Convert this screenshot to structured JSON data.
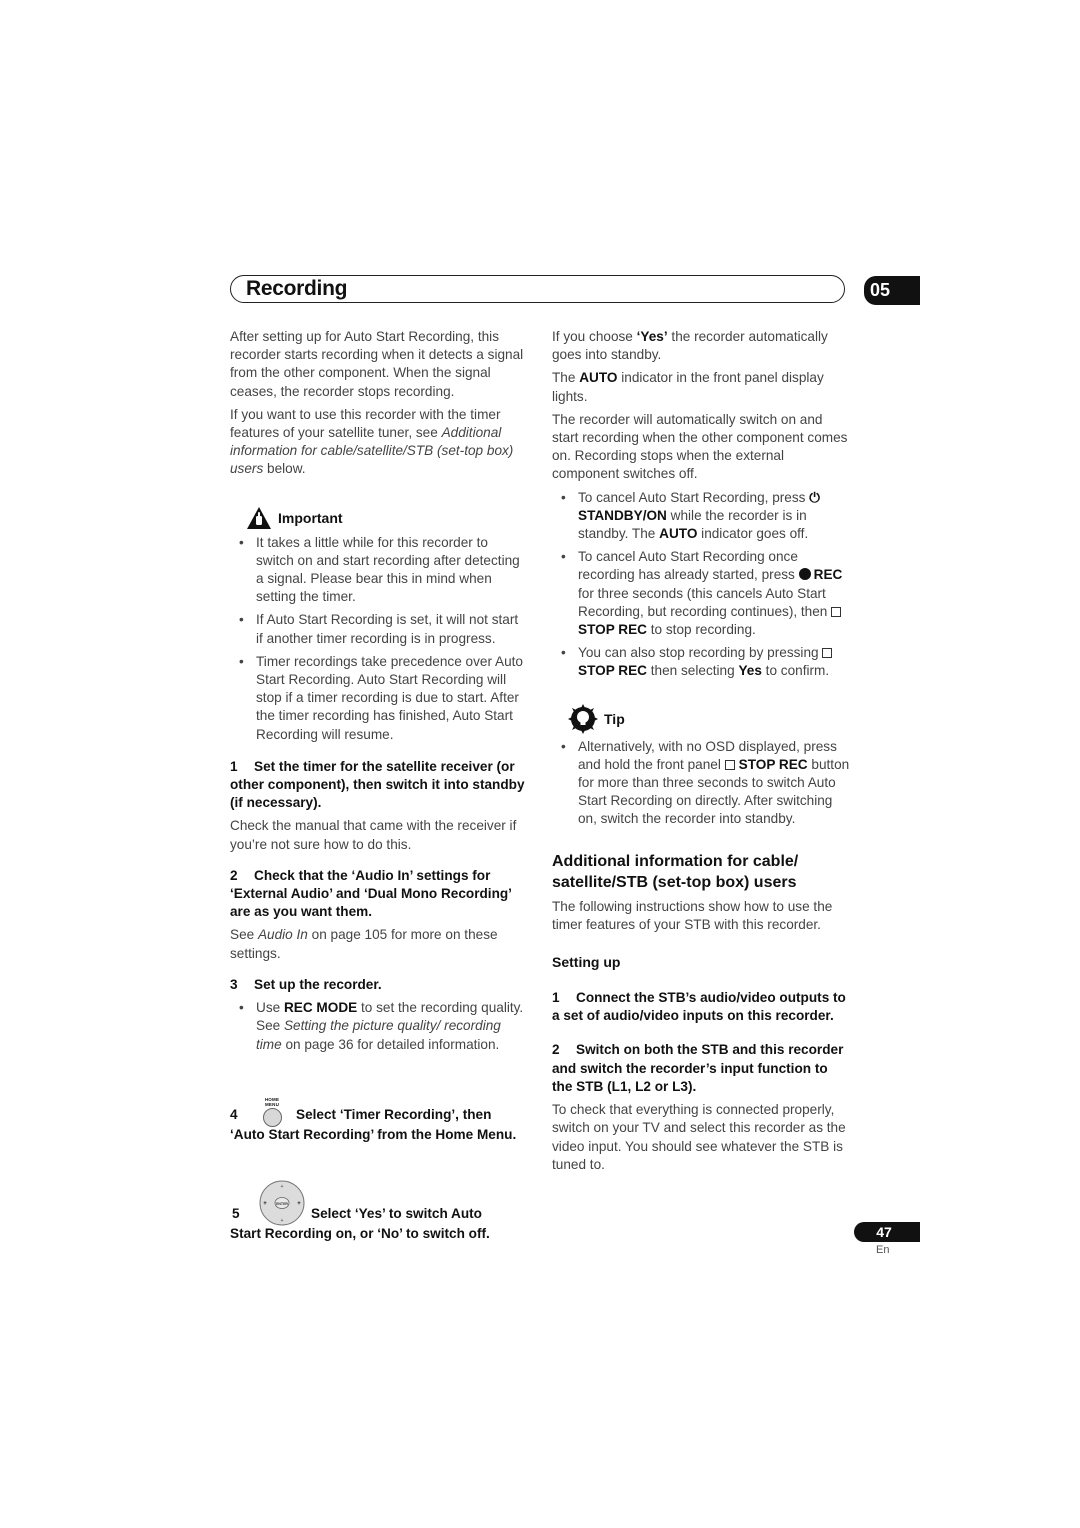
{
  "header": {
    "title": "Recording",
    "chapter": "05"
  },
  "left": {
    "intro1": "After setting up for Auto Start Recording, this recorder starts recording when it detects a signal from the other component. When the signal ceases, the recorder stops recording.",
    "intro2_a": "If you want to use this recorder with the timer features of your satellite tuner, see ",
    "intro2_link": "Additional information for cable/satellite/STB (set-top box) users",
    "intro2_b": " below.",
    "important": {
      "icon": "warning-hand-icon",
      "label": "Important",
      "bullets": [
        "It takes a little while for this recorder to switch on and start recording after detecting a signal. Please bear this in mind when setting the timer.",
        "If Auto Start Recording is set, it will not start if another timer recording is in progress.",
        "Timer recordings take precedence over Auto Start Recording. Auto Start Recording will stop if a timer recording is due to start. After the timer recording has finished, Auto Start Recording will resume."
      ]
    },
    "step1": {
      "num": "1",
      "title": "Set the timer for the satellite receiver (or other component), then switch it into standby (if necessary).",
      "body": "Check the manual that came with the receiver if you’re not sure how to do this."
    },
    "step2": {
      "num": "2",
      "title": "Check that the ‘Audio In’ settings for ‘External Audio’ and ‘Dual Mono Recording’ are as you want them.",
      "body_a": "See ",
      "body_link": "Audio In",
      "body_b": " on page 105 for more on these settings."
    },
    "step3": {
      "num": "3",
      "title": "Set up the recorder.",
      "bullet_a": "Use ",
      "bullet_bold": "REC MODE",
      "bullet_b": " to set the recording quality. See ",
      "bullet_link": "Setting the picture quality/ recording time",
      "bullet_c": " on page 36 for detailed information."
    },
    "step4": {
      "num": "4",
      "icon": "home-menu-button-icon",
      "icon_label": "HOME MENU",
      "title": "Select ‘Timer Recording’, then ‘Auto Start Recording’ from the Home Menu."
    },
    "step5": {
      "num": "5",
      "icon": "enter-dpad-icon",
      "icon_label": "ENTER",
      "title_a": "Select ‘Yes’ to switch Auto",
      "title_b": "Start Recording on, or ‘No’ to switch off."
    }
  },
  "right": {
    "p1_a": "If you choose ",
    "p1_bold": "‘Yes’",
    "p1_b": " the recorder automatically goes into standby.",
    "p2_a": "The ",
    "p2_bold": "AUTO",
    "p2_b": " indicator in the front panel display lights.",
    "p3": "The recorder will automatically switch on and start recording when the other component comes on. Recording stops when the external component switches off.",
    "b1": {
      "a": "To cancel Auto Start Recording, press ",
      "icon": "power-icon",
      "bold1": "STANDBY/ON",
      "b": " while the recorder is in standby. The ",
      "bold2": "AUTO",
      "c": " indicator goes off."
    },
    "b2": {
      "a": "To cancel Auto Start Recording once recording has already started, press ",
      "icon1": "rec-dot-icon",
      "bold1": "REC",
      "b": " for three seconds (this cancels Auto Start Recording, but recording continues), then ",
      "icon2": "stop-square-icon",
      "bold2": "STOP REC",
      "c": " to stop recording."
    },
    "b3": {
      "a": "You can also stop recording by pressing ",
      "icon": "stop-square-icon",
      "bold1": "STOP REC",
      "b": " then selecting ",
      "bold2": "Yes",
      "c": " to confirm."
    },
    "tip": {
      "icon": "lightbulb-gear-icon",
      "label": "Tip",
      "a": "Alternatively, with no OSD displayed, press and hold the front panel ",
      "icon2": "stop-square-icon",
      "bold": "STOP REC",
      "b": " button for more than three seconds to switch Auto Start Recording on directly. After switching on, switch the recorder into standby."
    },
    "section_title": "Additional information for cable/ satellite/STB (set-top box) users",
    "section_body": "The following instructions show how to use the timer features of your STB with this recorder.",
    "setting_up": "Setting up",
    "s1": {
      "num": "1",
      "title": "Connect the STB’s audio/video outputs to a set of audio/video inputs on this recorder."
    },
    "s2": {
      "num": "2",
      "title": "Switch on both the STB and this recorder and switch the recorder’s input function to the STB (L1, L2 or L3).",
      "body": "To check that everything is connected properly, switch on your TV and select this recorder as the video input. You should see whatever the STB is tuned to."
    }
  },
  "footer": {
    "page_number": "47",
    "language": "En"
  }
}
